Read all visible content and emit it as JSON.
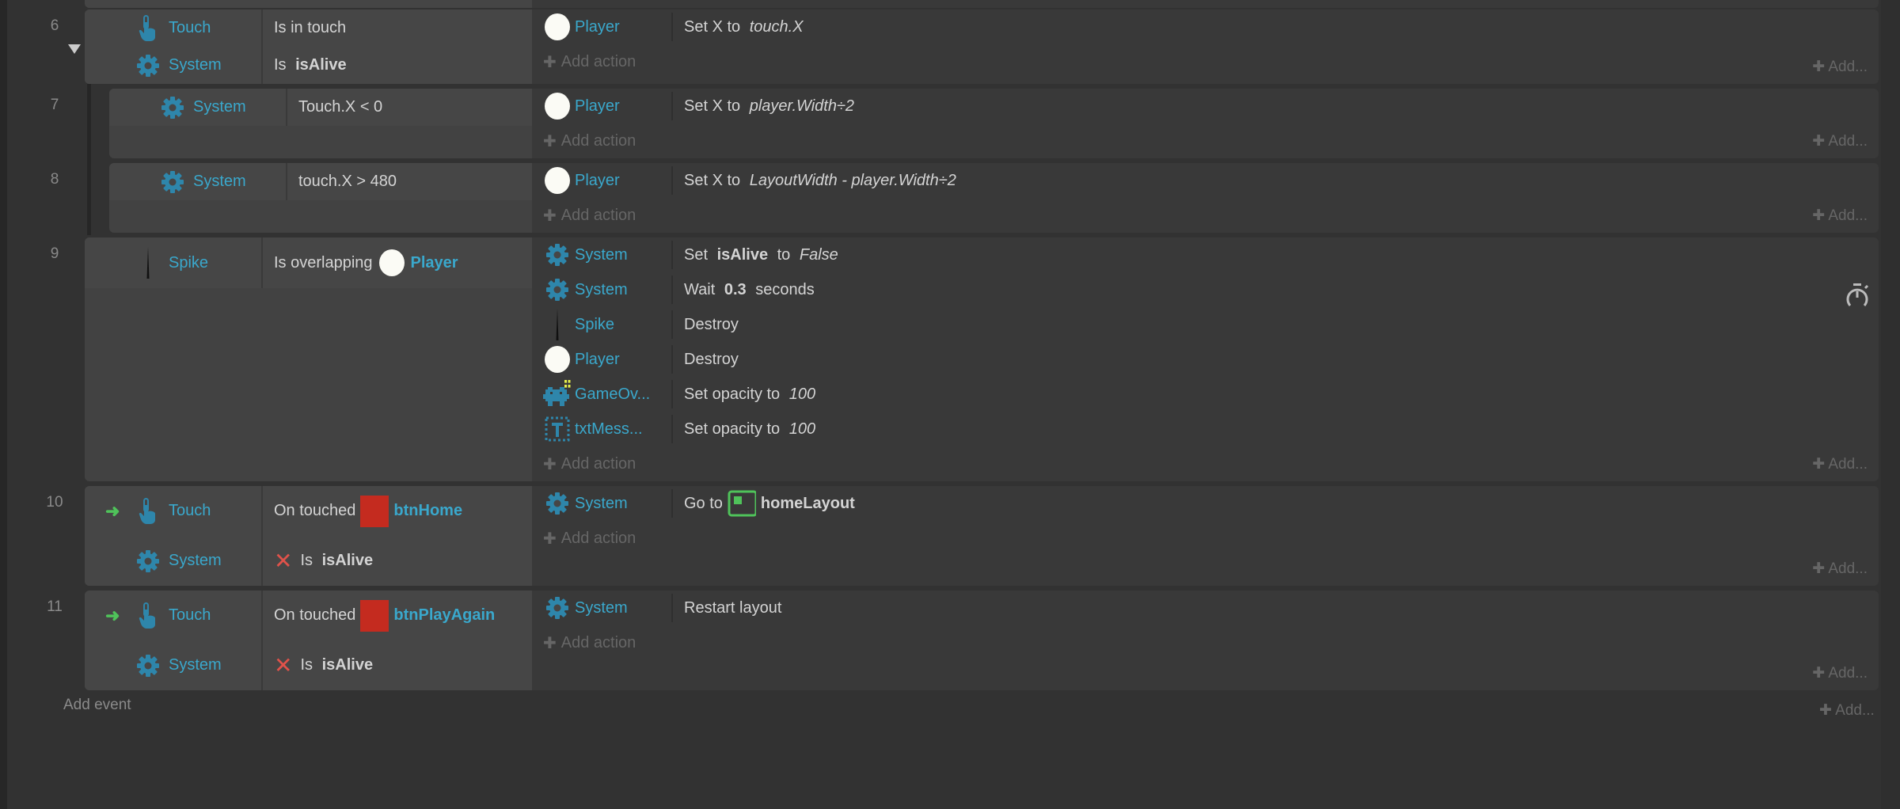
{
  "colors": {
    "object_name": "#3aa8cc",
    "trigger": "#4fc35a",
    "invert": "#e0524a",
    "button_sprite": "#c42b1f",
    "layout_icon": "#4fc35a"
  },
  "labels": {
    "add_action": "Add action",
    "add_more": "Add...",
    "add_event": "Add event"
  },
  "events": [
    {
      "number": "6",
      "collapsible": true,
      "cond_h": 47,
      "conditions": [
        {
          "object": "Touch",
          "icon": "touch-icon",
          "text": [
            {
              "t": "Is in touch"
            }
          ]
        },
        {
          "object": "System",
          "icon": "gear-icon",
          "text": [
            {
              "t": "Is "
            },
            {
              "t": "isAlive",
              "s": "b"
            }
          ]
        }
      ],
      "actions": [
        {
          "object": "Player",
          "icon": "player-circle-icon",
          "text": [
            {
              "t": "Set X to "
            },
            {
              "t": "touch.X",
              "s": "i"
            }
          ]
        }
      ]
    },
    {
      "number": "7",
      "sub": true,
      "cond_h": 47,
      "conditions": [
        {
          "object": "System",
          "icon": "gear-icon",
          "text": [
            {
              "t": "Touch.X < 0"
            }
          ]
        }
      ],
      "actions": [
        {
          "object": "Player",
          "icon": "player-circle-icon",
          "text": [
            {
              "t": "Set X to "
            },
            {
              "t": "player.Width÷2",
              "s": "i"
            }
          ]
        }
      ]
    },
    {
      "number": "8",
      "sub": true,
      "cond_h": 47,
      "conditions": [
        {
          "object": "System",
          "icon": "gear-icon",
          "text": [
            {
              "t": "touch.X > 480"
            }
          ]
        }
      ],
      "actions": [
        {
          "object": "Player",
          "icon": "player-circle-icon",
          "text": [
            {
              "t": "Set X to "
            },
            {
              "t": "LayoutWidth - player.Width÷2",
              "s": "i"
            }
          ]
        }
      ]
    },
    {
      "number": "9",
      "cond_h": 64,
      "timer": true,
      "conditions": [
        {
          "object": "Spike",
          "icon": "spike-icon",
          "text": [
            {
              "t": "Is overlapping"
            },
            {
              "icon": "player-circle-icon"
            },
            {
              "t": "Player",
              "s": "tn"
            }
          ]
        }
      ],
      "actions": [
        {
          "object": "System",
          "icon": "gear-icon",
          "text": [
            {
              "t": "Set "
            },
            {
              "t": "isAlive",
              "s": "b"
            },
            {
              "t": " to "
            },
            {
              "t": "False",
              "s": "i"
            }
          ]
        },
        {
          "object": "System",
          "icon": "gear-icon",
          "text": [
            {
              "t": "Wait "
            },
            {
              "t": "0.3",
              "s": "b"
            },
            {
              "t": " seconds"
            }
          ]
        },
        {
          "object": "Spike",
          "icon": "spike-icon",
          "text": [
            {
              "t": "Destroy"
            }
          ]
        },
        {
          "object": "Player",
          "icon": "player-circle-icon",
          "text": [
            {
              "t": "Destroy"
            }
          ]
        },
        {
          "object": "GameOv...",
          "icon": "gameover-sprite-icon",
          "text": [
            {
              "t": "Set opacity to "
            },
            {
              "t": "100",
              "s": "i"
            }
          ]
        },
        {
          "object": "txtMess...",
          "icon": "text-object-icon",
          "text": [
            {
              "t": "Set opacity to "
            },
            {
              "t": "100",
              "s": "i"
            }
          ]
        }
      ]
    },
    {
      "number": "10",
      "cond_h": 63,
      "conditions": [
        {
          "object": "Touch",
          "icon": "touch-icon",
          "trigger": true,
          "text": [
            {
              "t": "On touched"
            },
            {
              "icon": "button-sprite-icon"
            },
            {
              "t": "btnHome",
              "s": "tn"
            }
          ]
        },
        {
          "object": "System",
          "icon": "gear-icon",
          "inverted": true,
          "text": [
            {
              "t": "Is "
            },
            {
              "t": "isAlive",
              "s": "b"
            }
          ]
        }
      ],
      "actions": [
        {
          "object": "System",
          "icon": "gear-icon",
          "text": [
            {
              "t": "Go to"
            },
            {
              "icon": "layout-icon"
            },
            {
              "t": "homeLayout",
              "s": "b"
            }
          ]
        }
      ]
    },
    {
      "number": "11",
      "cond_h": 63,
      "conditions": [
        {
          "object": "Touch",
          "icon": "touch-icon",
          "trigger": true,
          "text": [
            {
              "t": "On touched"
            },
            {
              "icon": "button-sprite-icon"
            },
            {
              "t": "btnPlayAgain",
              "s": "tn"
            }
          ]
        },
        {
          "object": "System",
          "icon": "gear-icon",
          "inverted": true,
          "text": [
            {
              "t": "Is "
            },
            {
              "t": "isAlive",
              "s": "b"
            }
          ]
        }
      ],
      "actions": [
        {
          "object": "System",
          "icon": "gear-icon",
          "text": [
            {
              "t": "Restart layout"
            }
          ]
        }
      ]
    }
  ]
}
